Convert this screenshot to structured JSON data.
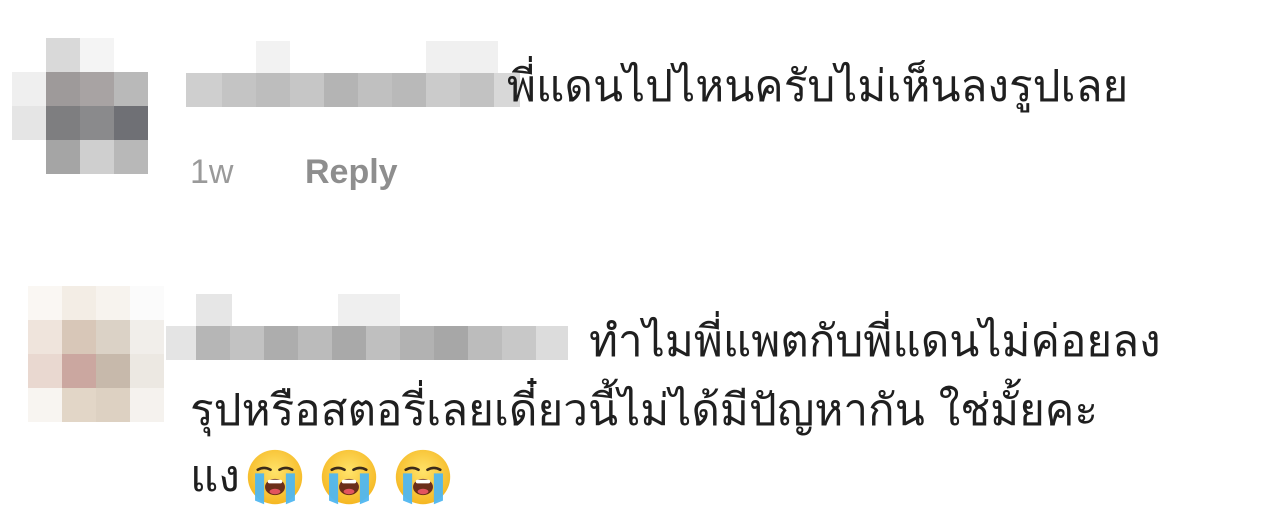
{
  "comments": [
    {
      "text": "พี่แดนไปไหนครับไม่เห็นลงรูปเลย",
      "time": "1w",
      "reply_label": "Reply"
    },
    {
      "line1": "ทำไมพี่แพตกับพี่แดนไม่ค่อยลง",
      "line2": "รุปหรือสตอรี่เลยเดี๋ยวนี้ไม่ได้มีปัญหากัน ใช่มั้ยคะ",
      "line3": "แง",
      "emojis": [
        "loudly-crying-face-icon",
        "loudly-crying-face-icon",
        "loudly-crying-face-icon"
      ]
    }
  ]
}
